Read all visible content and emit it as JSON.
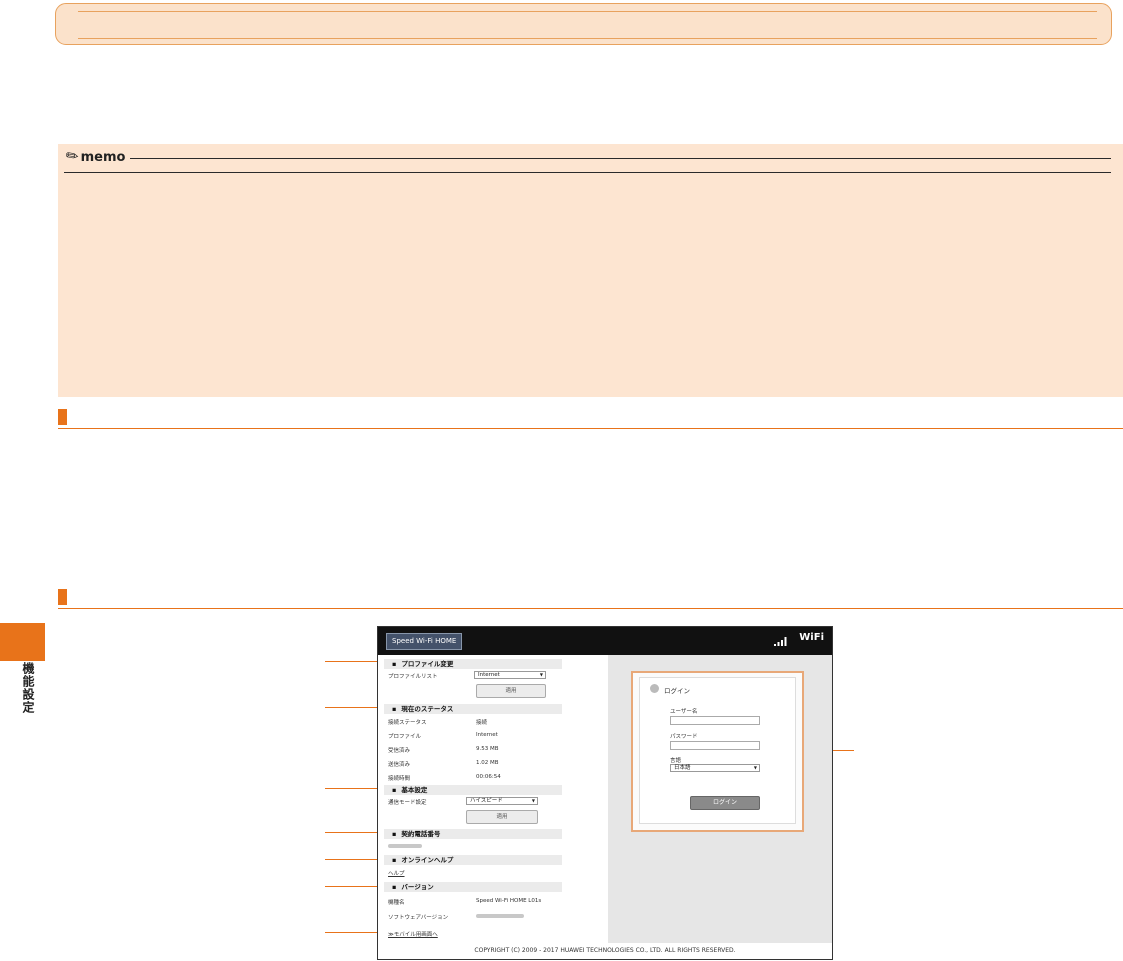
{
  "sidebar": {
    "section_label": "機能設定"
  },
  "memo": {
    "label": "memo"
  },
  "screenshot": {
    "logo": "Speed Wi-Fi HOME",
    "wifi_logo": "WiFi",
    "sections": {
      "profile": {
        "title": "プロファイル変更",
        "list_label": "プロファイルリスト",
        "list_value": "Internet",
        "apply": "適用"
      },
      "status": {
        "title": "現在のステータス",
        "rows": [
          {
            "label": "接続ステータス",
            "value": "接続"
          },
          {
            "label": "プロファイル",
            "value": "Internet"
          },
          {
            "label": "受信済み",
            "value": "9.53 MB"
          },
          {
            "label": "送信済み",
            "value": "1.02 MB"
          },
          {
            "label": "接続時間",
            "value": "00:06:54"
          }
        ]
      },
      "basic": {
        "title": "基本設定",
        "mode_label": "通信モード設定",
        "mode_value": "ハイスピード",
        "apply": "適用"
      },
      "phone": {
        "title": "契約電話番号"
      },
      "help": {
        "title": "オンラインヘルプ",
        "link": "ヘルプ"
      },
      "version": {
        "title": "バージョン",
        "rows": [
          {
            "label": "機種名",
            "value": "Speed Wi-Fi HOME L01s"
          },
          {
            "label": "ソフトウェアバージョン",
            "value": ""
          }
        ]
      },
      "mobile_link": "≫モバイル用画面へ"
    },
    "login": {
      "title": "ログイン",
      "username_label": "ユーザー名",
      "password_label": "パスワード",
      "language_label": "言語",
      "language_value": "日本語",
      "button": "ログイン"
    },
    "footer": "COPYRIGHT (C) 2009 - 2017 HUAWEI TECHNOLOGIES CO., LTD. ALL RIGHTS RESERVED."
  },
  "colors": {
    "accent": "#e8731a",
    "banner_fill": "#fbe2cb",
    "memo_fill": "#fde5d1"
  }
}
